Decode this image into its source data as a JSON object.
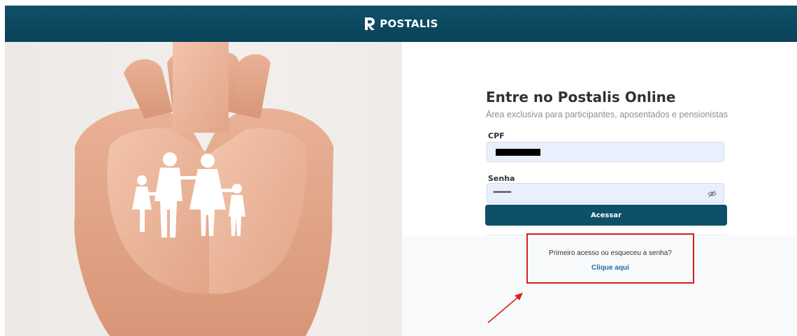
{
  "header": {
    "brand": "POSTALIS"
  },
  "login": {
    "title": "Entre no Postalis Online",
    "subtitle": "Área exclusiva para participantes, aposentados e pensionistas",
    "cpf_label": "CPF",
    "password_label": "Senha",
    "password_value": "••••••••••••",
    "submit_label": "Acessar"
  },
  "help": {
    "text": "Primeiro acesso ou esqueceu a senha?",
    "link": "Clique aqui"
  },
  "colors": {
    "header": "#0f5068",
    "button": "#0d5169",
    "input_bg": "#e9effc",
    "link": "#1a6fa8",
    "annotation": "#d62020"
  },
  "icons": {
    "password_toggle": "eye-off-icon",
    "annotation": "arrow-icon"
  }
}
